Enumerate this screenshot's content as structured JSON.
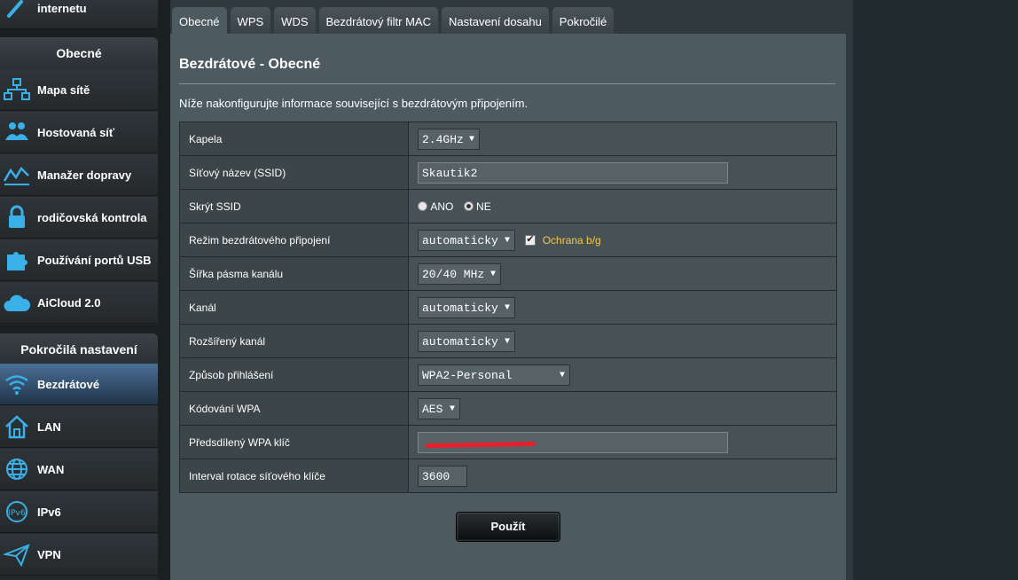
{
  "sidebar": {
    "top_partial_label": "internetu",
    "general_heading": "Obecné",
    "general_items": [
      {
        "label": "Mapa sítě",
        "icon": "network-map-icon"
      },
      {
        "label": "Hostovaná síť",
        "icon": "guest-network-icon"
      },
      {
        "label": "Manažer dopravy",
        "icon": "traffic-manager-icon"
      },
      {
        "label": "rodičovská kontrola",
        "icon": "parental-control-icon"
      },
      {
        "label": "Používání portů USB",
        "icon": "usb-icon"
      },
      {
        "label": "AiCloud 2.0",
        "icon": "cloud-icon"
      }
    ],
    "advanced_heading": "Pokročilá nastavení",
    "advanced_items": [
      {
        "label": "Bezdrátové",
        "icon": "wifi-icon",
        "active": true
      },
      {
        "label": "LAN",
        "icon": "home-icon"
      },
      {
        "label": "WAN",
        "icon": "globe-icon"
      },
      {
        "label": "IPv6",
        "icon": "ipv6-icon"
      },
      {
        "label": "VPN",
        "icon": "vpn-icon"
      }
    ]
  },
  "tabs": [
    "Obecné",
    "WPS",
    "WDS",
    "Bezdrátový filtr MAC",
    "Nastavení dosahu",
    "Pokročilé"
  ],
  "page": {
    "title": "Bezdrátové - Obecné",
    "description": "Níže nakonfigurujte informace související s bezdrátovým připojením."
  },
  "form": {
    "band_label": "Kapela",
    "band_value": "2.4GHz",
    "ssid_label": "Síťový název (SSID)",
    "ssid_value": "Skautik2",
    "hide_ssid_label": "Skrýt SSID",
    "hide_ssid_yes": "ANO",
    "hide_ssid_no": "NE",
    "mode_label": "Režim bezdrátového připojení",
    "mode_value": "automaticky",
    "mode_checkbox_label": "Ochrana b/g",
    "bandwidth_label": "Šířka pásma kanálu",
    "bandwidth_value": "20/40 MHz",
    "channel_label": "Kanál",
    "channel_value": "automaticky",
    "ext_channel_label": "Rozšířený kanál",
    "ext_channel_value": "automaticky",
    "auth_label": "Způsob přihlášení",
    "auth_value": "WPA2-Personal",
    "wpa_enc_label": "Kódování WPA",
    "wpa_enc_value": "AES",
    "psk_label": "Předsdílený WPA klíč",
    "rekey_label": "Interval rotace síťového klíče",
    "rekey_value": "3600"
  },
  "apply_label": "Použít",
  "colors": {
    "accent_checkbox_label": "#f6c64a",
    "active_item": "#4a6f96",
    "panel_bg": "#4d5a5f"
  }
}
